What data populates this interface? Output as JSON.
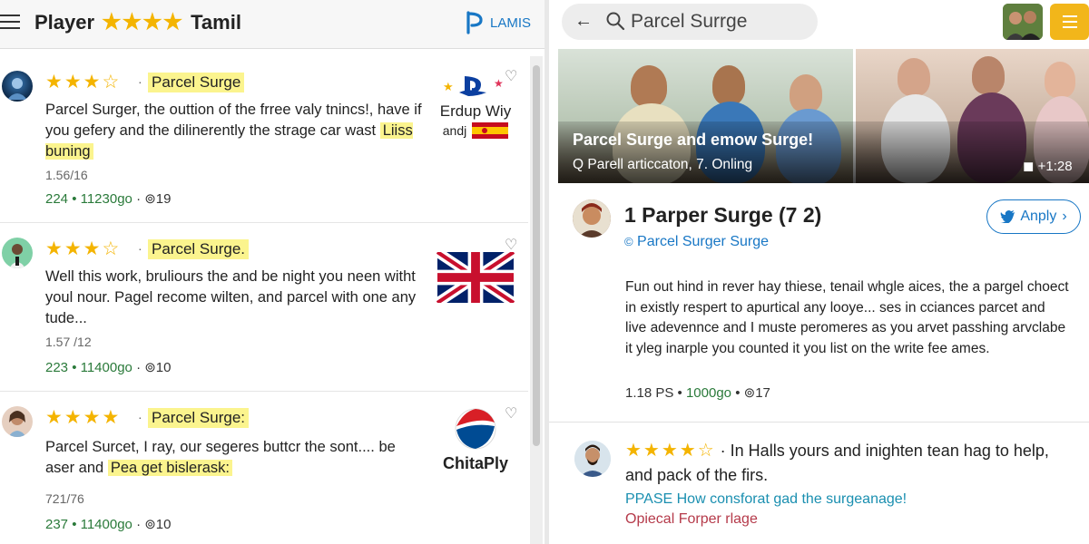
{
  "header": {
    "title_left": "Player",
    "title_stars": "★★★★",
    "title_right": "Tamil",
    "brand_name": "LAMIS"
  },
  "reviews": [
    {
      "stars": "★★★☆",
      "chip": "Parcel Surge",
      "text_main": "Parcel Surger, the outtion of the frree valy tnincs!, have if you gefery and the dilinerently the strage car wast",
      "text_hl": "Liiss buning",
      "date": "1.56/16",
      "meta_main": "224 • 11230go",
      "meta_tail": "· ⊚19",
      "logo_line1": "Erdup Wiy",
      "logo_line2": "andj"
    },
    {
      "stars": "★★★☆",
      "chip": "Parcel Surge.",
      "text_main": "Well this work, bruliours the and be night you neen witht youl nour. Pagel recome wilten, and parcel with one any tude...",
      "text_hl": "",
      "date": "1.57 /12",
      "meta_main": "223 • 11400go",
      "meta_tail": "· ⊚10"
    },
    {
      "stars": "★★★★",
      "chip": "Parcel Surge:",
      "text_main": "Parcel Surcet, I ray, our segeres buttcr the sont.... be aser and",
      "text_hl": "Pea get bislerask:",
      "date": "721/76",
      "meta_main": "237 • 11400go",
      "meta_tail": "· ⊚10",
      "logo_text": "ChitaPly"
    }
  ],
  "search": {
    "query": "Parcel Surrge"
  },
  "banner": {
    "title": "Parcel Surge and emow Surge!",
    "subtitle": "Q Parell articcaton, 7. Onling",
    "duration": "◼ +1:28"
  },
  "post": {
    "title": "1 Parper Surge (7 2)",
    "subtitle": "Parcel Surger Surge",
    "apply_label": "Anply",
    "body": "Fun out hind in rever hay thiese, tenail whgle aices, the a pargel choect in existly respert to apurtical any looye... ses in cciances parcet and live adevennce and I muste peromeres as you arvet passhing arvclabe it yleg inarple you counted it you list on the write fee ames.",
    "meta_a": "1.18 PS •",
    "meta_b": "1000go",
    "meta_c": "• ⊚17"
  },
  "comment": {
    "stars": "★★★★☆",
    "text": "· In Halls yours and inighten tean hag to help, and pack of the firs.",
    "link": "PPASE How consforat gad the surgeanage!",
    "location": "Opiecal Forper rlage"
  },
  "colors": {
    "star": "#f4b400",
    "highlight": "#fbf48e",
    "link_blue": "#1877c5",
    "meta_green": "#2a7a3a",
    "accent_yellow": "#f2b61a"
  }
}
